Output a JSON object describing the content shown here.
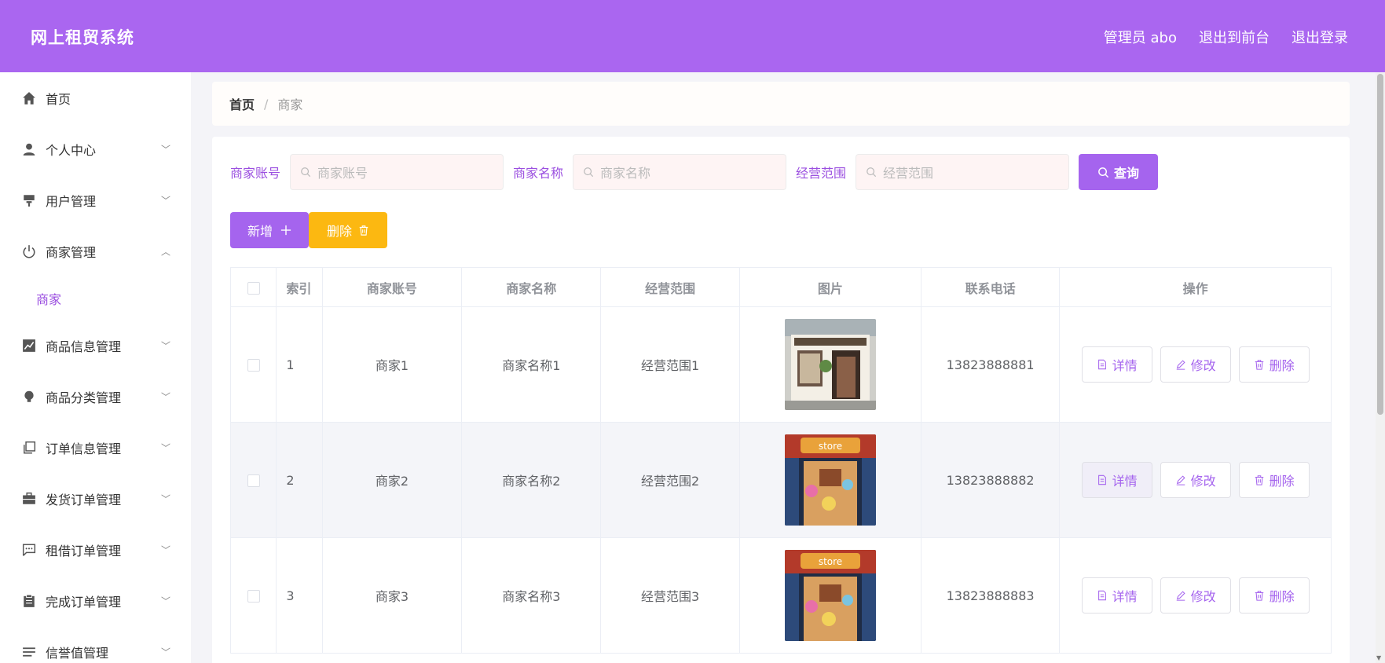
{
  "app": {
    "title": "网上租贸系统"
  },
  "topnav": {
    "admin": "管理员 abo",
    "front": "退出到前台",
    "logout": "退出登录"
  },
  "sidebar": {
    "items": [
      {
        "label": "首页",
        "icon": "home-icon",
        "expandable": false
      },
      {
        "label": "个人中心",
        "icon": "user-icon",
        "expandable": true
      },
      {
        "label": "用户管理",
        "icon": "users-icon",
        "expandable": true
      },
      {
        "label": "商家管理",
        "icon": "power-icon",
        "expandable": true,
        "expanded": true
      },
      {
        "label": "商品信息管理",
        "icon": "chart-icon",
        "expandable": true
      },
      {
        "label": "商品分类管理",
        "icon": "bulb-icon",
        "expandable": true
      },
      {
        "label": "订单信息管理",
        "icon": "copy-icon",
        "expandable": true
      },
      {
        "label": "发货订单管理",
        "icon": "briefcase-icon",
        "expandable": true
      },
      {
        "label": "租借订单管理",
        "icon": "chat-icon",
        "expandable": true
      },
      {
        "label": "完成订单管理",
        "icon": "clipboard-icon",
        "expandable": true
      },
      {
        "label": "信誉值管理",
        "icon": "list-icon",
        "expandable": true
      }
    ],
    "sub_item": "商家"
  },
  "breadcrumb": {
    "home": "首页",
    "separator": "/",
    "current": "商家"
  },
  "search": {
    "account_label": "商家账号",
    "account_placeholder": "商家账号",
    "name_label": "商家名称",
    "name_placeholder": "商家名称",
    "scope_label": "经营范围",
    "scope_placeholder": "经营范围",
    "query_button": "查询"
  },
  "actions": {
    "add": "新增",
    "delete": "删除"
  },
  "table": {
    "headers": [
      "索引",
      "商家账号",
      "商家名称",
      "经营范围",
      "图片",
      "联系电话",
      "操作"
    ],
    "rows": [
      {
        "index": "1",
        "account": "商家1",
        "name": "商家名称1",
        "scope": "经营范围1",
        "image": "storefront-white",
        "phone": "13823888881"
      },
      {
        "index": "2",
        "account": "商家2",
        "name": "商家名称2",
        "scope": "经营范围2",
        "image": "storefront-red",
        "phone": "13823888882"
      },
      {
        "index": "3",
        "account": "商家3",
        "name": "商家名称3",
        "scope": "经营范围3",
        "image": "storefront-red",
        "phone": "13823888883"
      }
    ],
    "ops": {
      "detail": "详情",
      "edit": "修改",
      "delete": "删除"
    }
  },
  "colors": {
    "header": "#aa66f0",
    "primary": "#a564ee",
    "warning": "#fcb811",
    "accent_text": "#9b4fe0"
  }
}
